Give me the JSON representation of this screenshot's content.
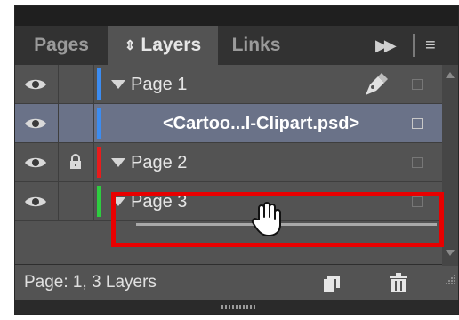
{
  "tabs": [
    {
      "label": "Pages",
      "active": false
    },
    {
      "label": "Layers",
      "active": true,
      "icon": "up-down-arrows-icon"
    },
    {
      "label": "Links",
      "active": false
    }
  ],
  "tab_icons": {
    "updown": "⇕",
    "more_tabs": "▶▶",
    "menu": "≡"
  },
  "rows": [
    {
      "label": "Page 1",
      "type": "layer",
      "visible": true,
      "locked": false,
      "color": "#3c8cf0",
      "expanded": true,
      "has_pen": true
    },
    {
      "label": "<Cartoo...l-Clipart.psd>",
      "type": "item",
      "visible": true,
      "locked": false,
      "color": "#3c8cf0",
      "selected": true
    },
    {
      "label": "Page 2",
      "type": "layer",
      "visible": true,
      "locked": true,
      "color": "#e81c1c",
      "expanded": true
    },
    {
      "label": "Page 3",
      "type": "layer",
      "visible": true,
      "locked": false,
      "color": "#2ecc40",
      "expanded": true
    }
  ],
  "status": {
    "text": "Page: 1, 3 Layers"
  },
  "colors": {
    "highlight": "#e80000",
    "panel": "#535353",
    "selected_row": "#6a7288"
  }
}
